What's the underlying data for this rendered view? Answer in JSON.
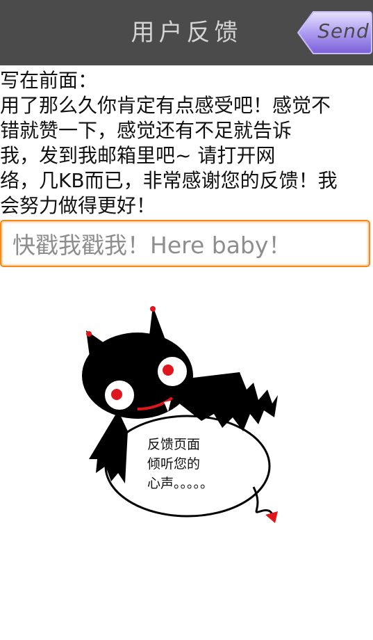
{
  "header": {
    "title": "用户反馈",
    "send_label": "Send"
  },
  "intro": {
    "lines": [
      "写在前面：",
      "用了那么久你肯定有点感受吧！感觉不",
      "错就赞一下，感觉还有不足就告诉",
      "我，发到我邮箱里吧~ 请打开网",
      "络，几KB而已，非常感谢您的反馈！我",
      "会努力做得更好！"
    ]
  },
  "feedback_input": {
    "value": "",
    "placeholder": "快戳我戳我！Here baby！"
  },
  "mascot": {
    "lines": [
      "反馈页面",
      "倾听您的",
      "心声。。。。。"
    ]
  },
  "colors": {
    "titlebar": "#4b4b4b",
    "send_button": "#9b88e6",
    "input_border": "#f28a1e",
    "mascot_eyes": "#e0161e"
  }
}
